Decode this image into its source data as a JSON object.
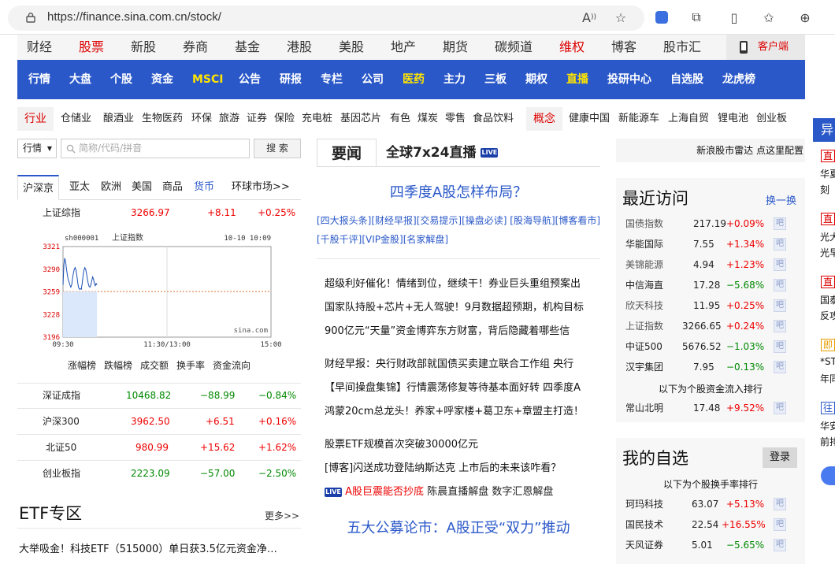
{
  "browser": {
    "url": "https://finance.sina.com.cn/stock/"
  },
  "topnav": {
    "items": [
      "财经",
      "股票",
      "新股",
      "券商",
      "基金",
      "港股",
      "美股",
      "地产",
      "期货",
      "碳频道",
      "维权",
      "博客",
      "股市汇"
    ],
    "client": "客户端"
  },
  "bluenav": {
    "items": [
      "行情",
      "大盘",
      "个股",
      "资金",
      "MSCI",
      "公告",
      "研报",
      "专栏",
      "公司",
      "医药",
      "主力",
      "三板",
      "期权",
      "直播",
      "投研中心",
      "自选股",
      "龙虎榜"
    ]
  },
  "industry": {
    "tag": "行业",
    "items": [
      "仓储业",
      "酿酒业",
      "生物医药",
      "环保",
      "旅游",
      "证券",
      "保险",
      "充电桩",
      "基因芯片",
      "有色",
      "煤炭",
      "零售",
      "食品饮料"
    ],
    "concept_tag": "概念",
    "concepts": [
      "健康中国",
      "新能源车",
      "上海自贸",
      "锂电池",
      "创业板"
    ]
  },
  "search": {
    "select": "行情",
    "placeholder": "简称/代码/拼音",
    "button": "搜 索"
  },
  "market_tabs": [
    "沪深京",
    "亚太",
    "欧洲",
    "美国",
    "商品",
    "货币",
    "环球市场>>"
  ],
  "main_index": {
    "name": "上证综指",
    "value": "3266.97",
    "change": "+8.11",
    "pct": "+0.25%"
  },
  "chart_data": {
    "type": "line",
    "title": "上证指数",
    "code": "sh000001",
    "time_label": "10-10 10:09",
    "watermark": "sina.com",
    "y_ticks": [
      "3321",
      "3290",
      "3259",
      "3228",
      "3196"
    ],
    "x_ticks": [
      "09:30",
      "11:30/13:00",
      "15:00"
    ],
    "ylim": [
      3196,
      3321
    ],
    "prev_close": 3258.86,
    "x": [
      0,
      1,
      2,
      3,
      4,
      5,
      6,
      7,
      8,
      9,
      10,
      11,
      12,
      13,
      14,
      15,
      16,
      17,
      18,
      19,
      20,
      21,
      22,
      23,
      24,
      25,
      26,
      27,
      28,
      29,
      30,
      31,
      32,
      33,
      34,
      35,
      36,
      37,
      38,
      39
    ],
    "values": [
      3268,
      3296,
      3305,
      3300,
      3290,
      3282,
      3275,
      3272,
      3268,
      3265,
      3268,
      3278,
      3285,
      3290,
      3292,
      3288,
      3280,
      3270,
      3264,
      3262,
      3263,
      3262,
      3270,
      3280,
      3288,
      3292,
      3290,
      3284,
      3276,
      3270,
      3266,
      3265,
      3268,
      3274,
      3279,
      3276,
      3270,
      3267,
      3270,
      3268
    ],
    "total_points": 240
  },
  "market_links": [
    "涨幅榜",
    "跌幅榜",
    "成交额",
    "换手率",
    "资金流向"
  ],
  "indices": [
    {
      "name": "深证成指",
      "value": "10468.82",
      "change": "−88.99",
      "pct": "−0.84%",
      "dir": "down"
    },
    {
      "name": "沪深300",
      "value": "3962.50",
      "change": "+6.51",
      "pct": "+0.16%",
      "dir": "up"
    },
    {
      "name": "北证50",
      "value": "980.99",
      "change": "+15.62",
      "pct": "+1.62%",
      "dir": "up"
    },
    {
      "name": "创业板指",
      "value": "2223.09",
      "change": "−57.00",
      "pct": "−2.50%",
      "dir": "down"
    }
  ],
  "etf": {
    "title": "ETF专区",
    "more": "更多>>",
    "news": "大举吸金！科技ETF（515000）单日获3.5亿元资金净…"
  },
  "news_tabs": {
    "main": "要闻",
    "live": "全球7x24直播",
    "live_badge": "LIVE"
  },
  "headline": "四季度A股怎样布局？",
  "headline_links_1": "[四大报头条][财经早报][交易提示][操盘必读] [股海导航][博客看市]",
  "headline_links_2": "[千股千评][VIP金股][名家解盘]",
  "news": [
    "超级利好催化！情绪到位，继续干！券业巨头重组预案出",
    "国家队持股+芯片+无人驾驶！9月数据超预期，机构目标",
    "900亿元“天量”资金博弈东方财富，背后隐藏着哪些信",
    "财经早报：央行财政部就国债买卖建立联合工作组 央行",
    "【早间操盘集锦】行情震荡修复等待基本面好转 四季度A",
    "鸿蒙20cm总龙头！养家+呼家楼+葛卫东+章盟主打造！",
    "股票ETF规模首次突破30000亿元",
    "[博客]闪送成功登陆纳斯达克 上市后的未来该咋看？"
  ],
  "live_news": {
    "badge": "LIVE",
    "red_text": "A股巨震能否抄底",
    "text": "陈晨直播解盘 数字汇恩解盘"
  },
  "headline2": "五大公募论市：A股正受“双力”推动",
  "radar": "新浪股市雷达 点这里配置",
  "recent": {
    "title": "最近访问",
    "switch": "换一换",
    "rows": [
      {
        "name": "国债指数",
        "price": "217.19",
        "pct": "+0.09%",
        "dir": "up",
        "gray": true
      },
      {
        "name": "华能国际",
        "price": "7.55",
        "pct": "+1.34%",
        "dir": "up",
        "gray": false
      },
      {
        "name": "美锦能源",
        "price": "4.94",
        "pct": "+1.23%",
        "dir": "up",
        "gray": true
      },
      {
        "name": "中信海直",
        "price": "17.28",
        "pct": "−5.68%",
        "dir": "down",
        "gray": false
      },
      {
        "name": "欣天科技",
        "price": "11.95",
        "pct": "+0.25%",
        "dir": "up",
        "gray": true
      },
      {
        "name": "上证指数",
        "price": "3266.65",
        "pct": "+0.24%",
        "dir": "up",
        "gray": true
      },
      {
        "name": "中证500",
        "price": "5676.52",
        "pct": "−1.03%",
        "dir": "down",
        "gray": false
      },
      {
        "name": "汉宇集团",
        "price": "7.95",
        "pct": "−0.13%",
        "dir": "down",
        "gray": false
      }
    ],
    "rank_line": "以下为个股资金流入排行",
    "rank_row": {
      "name": "常山北明",
      "price": "17.48",
      "pct": "+9.52%",
      "dir": "up"
    },
    "ba": "吧"
  },
  "mystock": {
    "title": "我的自选",
    "login": "登录",
    "turnover_line": "以下为个股换手率排行",
    "rows": [
      {
        "name": "珂玛科技",
        "price": "63.07",
        "pct": "+5.13%",
        "dir": "up"
      },
      {
        "name": "国民技术",
        "price": "22.54",
        "pct": "+16.55%",
        "dir": "up"
      },
      {
        "name": "天风证券",
        "price": "5.01",
        "pct": "−5.65%",
        "dir": "down"
      }
    ]
  },
  "far_right": {
    "header": "异",
    "items": [
      {
        "tag": "直",
        "lines": [
          "华夏",
          "刻"
        ]
      },
      {
        "tag": "直",
        "lines": [
          "光大",
          "光早"
        ]
      },
      {
        "tag": "直",
        "lines": [
          "国泰",
          "反攻"
        ]
      },
      {
        "tag": "即",
        "lines": [
          "*ST",
          "年同"
        ]
      },
      {
        "tag": "往",
        "lines": [
          "华安",
          "前排"
        ]
      }
    ]
  },
  "colors": {
    "blue_nav": "#2a58c9",
    "up": "#e00000",
    "down": "#008000",
    "accent_yellow": "#ffe400"
  }
}
